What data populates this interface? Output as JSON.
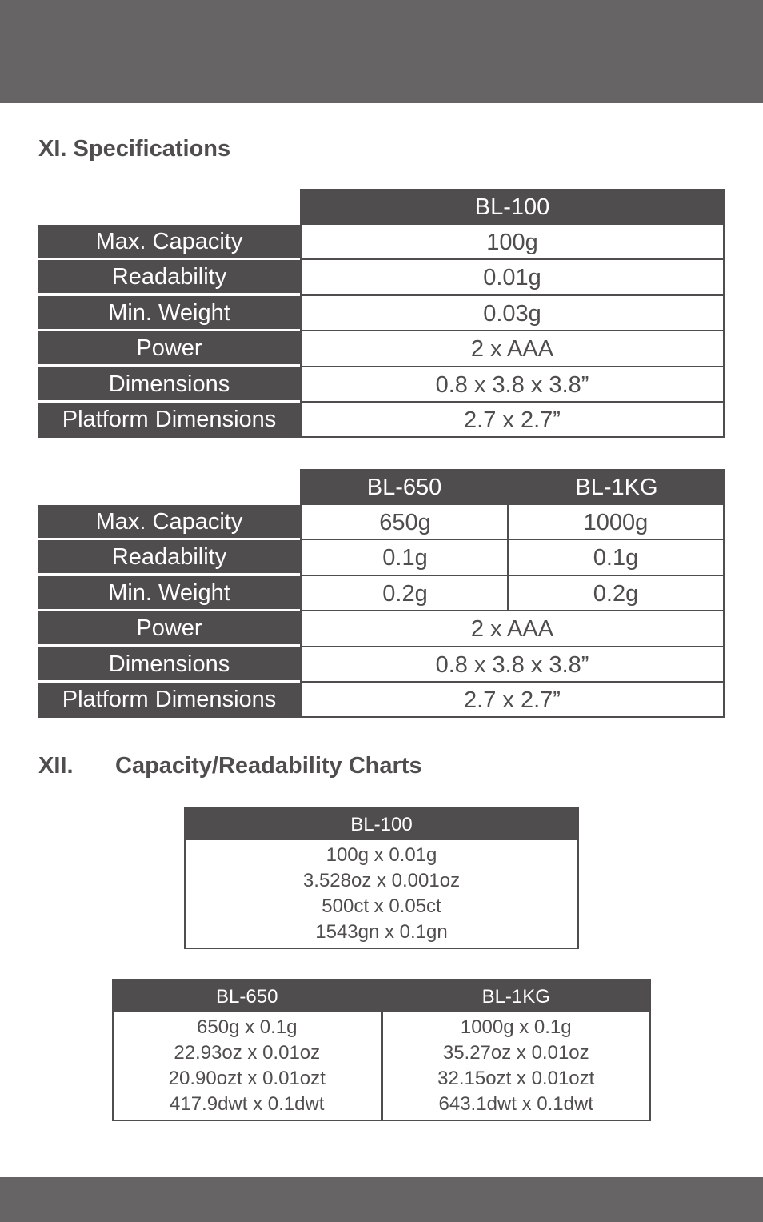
{
  "specifications": {
    "heading": "XI. Specifications",
    "table_bl100": {
      "models": [
        "BL-100"
      ],
      "rows": [
        {
          "label": "Max. Capacity",
          "values": [
            "100g"
          ]
        },
        {
          "label": "Readability",
          "values": [
            "0.01g"
          ]
        },
        {
          "label": "Min. Weight",
          "values": [
            "0.03g"
          ]
        },
        {
          "label": "Power",
          "values": [
            "2 x AAA"
          ]
        },
        {
          "label": "Dimensions",
          "values": [
            "0.8 x 3.8 x 3.8”"
          ]
        },
        {
          "label": "Platform Dimensions",
          "values": [
            "2.7 x 2.7”"
          ]
        }
      ]
    },
    "table_bl650_1kg": {
      "models": [
        "BL-650",
        "BL-1KG"
      ],
      "rows": [
        {
          "label": "Max. Capacity",
          "values": [
            "650g",
            "1000g"
          ]
        },
        {
          "label": "Readability",
          "values": [
            "0.1g",
            "0.1g"
          ]
        },
        {
          "label": "Min. Weight",
          "values": [
            "0.2g",
            "0.2g"
          ]
        },
        {
          "label": "Power",
          "values": [
            "2 x AAA"
          ]
        },
        {
          "label": "Dimensions",
          "values": [
            "0.8 x 3.8 x 3.8”"
          ]
        },
        {
          "label": "Platform Dimensions",
          "values": [
            "2.7 x 2.7”"
          ]
        }
      ]
    }
  },
  "capacity_charts": {
    "heading_number": "XII.",
    "heading_title": "Capacity/Readability Charts",
    "bl100": {
      "model": "BL-100",
      "lines": [
        "100g x 0.01g",
        "3.528oz x 0.001oz",
        "500ct x 0.05ct",
        "1543gn x 0.1gn"
      ]
    },
    "bl650": {
      "model": "BL-650",
      "lines": [
        "650g x 0.1g",
        "22.93oz x 0.01oz",
        "20.90ozt x 0.01ozt",
        "417.9dwt x 0.1dwt"
      ]
    },
    "bl1kg": {
      "model": "BL-1KG",
      "lines": [
        "1000g x 0.1g",
        "35.27oz x 0.01oz",
        "32.15ozt x 0.01ozt",
        "643.1dwt x 0.1dwt"
      ]
    }
  },
  "colors": {
    "band": "#666465",
    "table_dark": "#4f4d4e",
    "text": "#4f4d4e"
  }
}
